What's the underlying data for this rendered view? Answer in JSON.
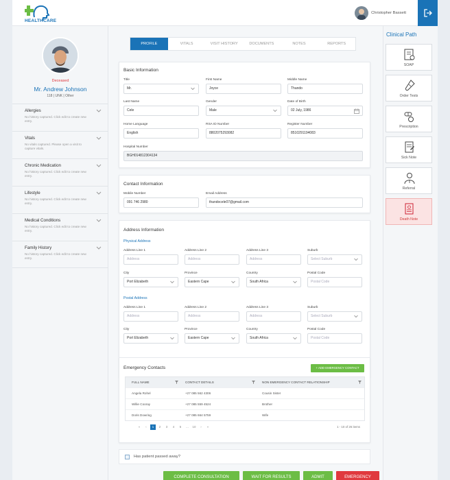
{
  "app": {
    "logo_text": "HEALTHCARE",
    "user_name": "Christopher Bassett"
  },
  "patient": {
    "status": "Deceased",
    "name": "Mr. Andrew Johnson",
    "meta": "118 | UNK | Other"
  },
  "history": [
    {
      "title": "Allergies",
      "desc": "No history captured. Click edit to create new entry."
    },
    {
      "title": "Vitals",
      "desc": "No vitals captured. Please open a visit to capture vitals."
    },
    {
      "title": "Chronic Medication",
      "desc": "No history captured. Click edit to create new entry."
    },
    {
      "title": "Lifestyle",
      "desc": "No history captured. Click edit to create new entry."
    },
    {
      "title": "Medical Conditions",
      "desc": "No history captured. Click edit to create new entry."
    },
    {
      "title": "Family History",
      "desc": "No history captured. Click edit to create new entry."
    }
  ],
  "tabs": [
    "PROFILE",
    "VITALS",
    "VISIT HISTORY",
    "DOCUMENTS",
    "NOTES",
    "REPORTS"
  ],
  "basic": {
    "title": "Basic Information",
    "title_label": "Title",
    "title_value": "Mr.",
    "first_label": "First Name",
    "first_value": "Joyce",
    "middle_label": "Middle Name",
    "middle_value": "Thando",
    "last_label": "Last Name",
    "last_value": "Cele",
    "gender_label": "Gender",
    "gender_value": "Male",
    "dob_label": "Date of Birth",
    "dob_value": "02 July, 1986",
    "lang_label": "Home Language",
    "lang_value": "English",
    "rsa_label": "RSA ID Number",
    "rsa_value": "8802075293082",
    "reg_label": "Register Number",
    "reg_value": "8510291194083",
    "hosp_label": "Hospital Number",
    "hosp_value": "BGH014812304134"
  },
  "contact": {
    "title": "Contact Information",
    "mobile_label": "Mobile Number",
    "mobile_value": "091 746 2980",
    "email_label": "Email Address",
    "email_value": "thandocele07@gmail.com"
  },
  "address": {
    "title": "Address Information",
    "physical_label": "Physical Address",
    "postal_label": "Postal Address",
    "line1_label": "Address Line 1",
    "line2_label": "Address Line 2",
    "line3_label": "Address Line 3",
    "suburb_label": "Suburb",
    "addr_placeholder": "Address",
    "suburb_placeholder": "Select Suburb",
    "city_label": "City",
    "city_value": "Port Elizabeth",
    "province_label": "Province",
    "province_value": "Eastern Cape",
    "country_label": "Country",
    "country_value": "South Africa",
    "postal_code_label": "Postal Code",
    "postal_code_placeholder": "Postal Code"
  },
  "emergency": {
    "title": "Emergency Contacts",
    "add_label": "+ ADD EMERGENCY CONTACT",
    "headers": [
      "FULL NAME",
      "CONTACT DETAILS",
      "NON EMERGENCY CONTACT RELATIONSHIP"
    ],
    "rows": [
      [
        "Angela Rohel",
        "+27 085 562 4306",
        "Cousin Sister"
      ],
      [
        "Willie Cooray",
        "+27 085 559 4524",
        "Brother"
      ],
      [
        "Doris Dowring",
        "+27 085 664 5759",
        "Wife"
      ]
    ],
    "pages": [
      "1",
      "2",
      "3",
      "4",
      "5",
      "...",
      "10"
    ],
    "page_info": "1 - 10 of 26 items"
  },
  "passed_label": "Has patient passed away?",
  "actions": [
    {
      "label": "COMPLETE CONSULTATION",
      "color": "#6cbd45"
    },
    {
      "label": "WAIT FOR RESULTS",
      "color": "#6cbd45"
    },
    {
      "label": "ADMIT",
      "color": "#6cbd45"
    },
    {
      "label": "EMERGENCY",
      "color": "#e0393e"
    }
  ],
  "clinical": {
    "title": "Clinical Path",
    "items": [
      {
        "label": "SOAP",
        "icon": "soap-icon"
      },
      {
        "label": "Order Tests",
        "icon": "test-tube-icon"
      },
      {
        "label": "Prescription",
        "icon": "pills-icon"
      },
      {
        "label": "Sick Note",
        "icon": "sick-note-icon"
      },
      {
        "label": "Referral",
        "icon": "doctor-icon"
      },
      {
        "label": "Death Note",
        "icon": "death-note-icon"
      }
    ]
  },
  "colors": {
    "primary": "#1a73b7",
    "accent": "#6cbd45",
    "danger": "#e0393e"
  }
}
